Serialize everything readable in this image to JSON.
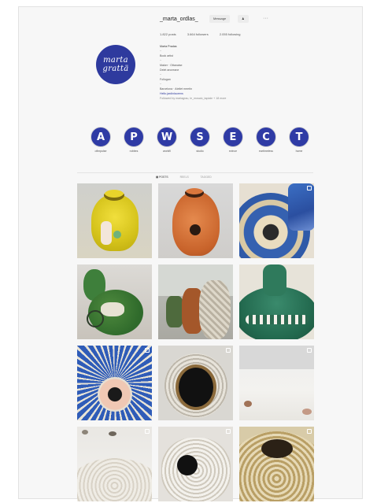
{
  "profile": {
    "avatar_text": [
      "marta",
      "grattä"
    ],
    "username": "_marta_ordlas_",
    "buttons": [
      "Message",
      "♟",
      "···"
    ],
    "stats": [
      "1.822 posts",
      "3.664 followers",
      "2.055 following"
    ],
    "bio": [
      "Marta Pradas",
      "··",
      "Book artist",
      "··",
      "Maker · Ottanaise",
      "Delet ancreane",
      "··",
      "Follugan",
      "··",
      "Barcelona · Ateliet meetin",
      "Hello.jardinlaurens",
      "Followed by mariagrau, le_mosaic_tapiale + 18 more"
    ]
  },
  "highlights": [
    {
      "letter": "A",
      "label": "ofimpulse"
    },
    {
      "letter": "P",
      "label": "robbes"
    },
    {
      "letter": "W",
      "label": "workfil"
    },
    {
      "letter": "S",
      "label": "studio"
    },
    {
      "letter": "E",
      "label": "evince"
    },
    {
      "letter": "C",
      "label": "eartimeless"
    },
    {
      "letter": "T",
      "label": "home"
    }
  ],
  "tabs": [
    "▦ POSTS",
    "REELS",
    "TAGGED"
  ],
  "colors": {
    "accent": "#2e3a9e",
    "highlight": "#2f3ba5"
  },
  "posts_grid": [
    {
      "name": "yellow-vessel"
    },
    {
      "name": "terracotta-vessel"
    },
    {
      "name": "blue-ring-vessel"
    },
    {
      "name": "green-pots"
    },
    {
      "name": "shelf-vessels"
    },
    {
      "name": "green-rope-sculpture"
    },
    {
      "name": "blue-pink-ring"
    },
    {
      "name": "white-knit-opening"
    },
    {
      "name": "white-table"
    },
    {
      "name": "white-detail"
    },
    {
      "name": "white-hole"
    },
    {
      "name": "beige-spiral"
    }
  ]
}
